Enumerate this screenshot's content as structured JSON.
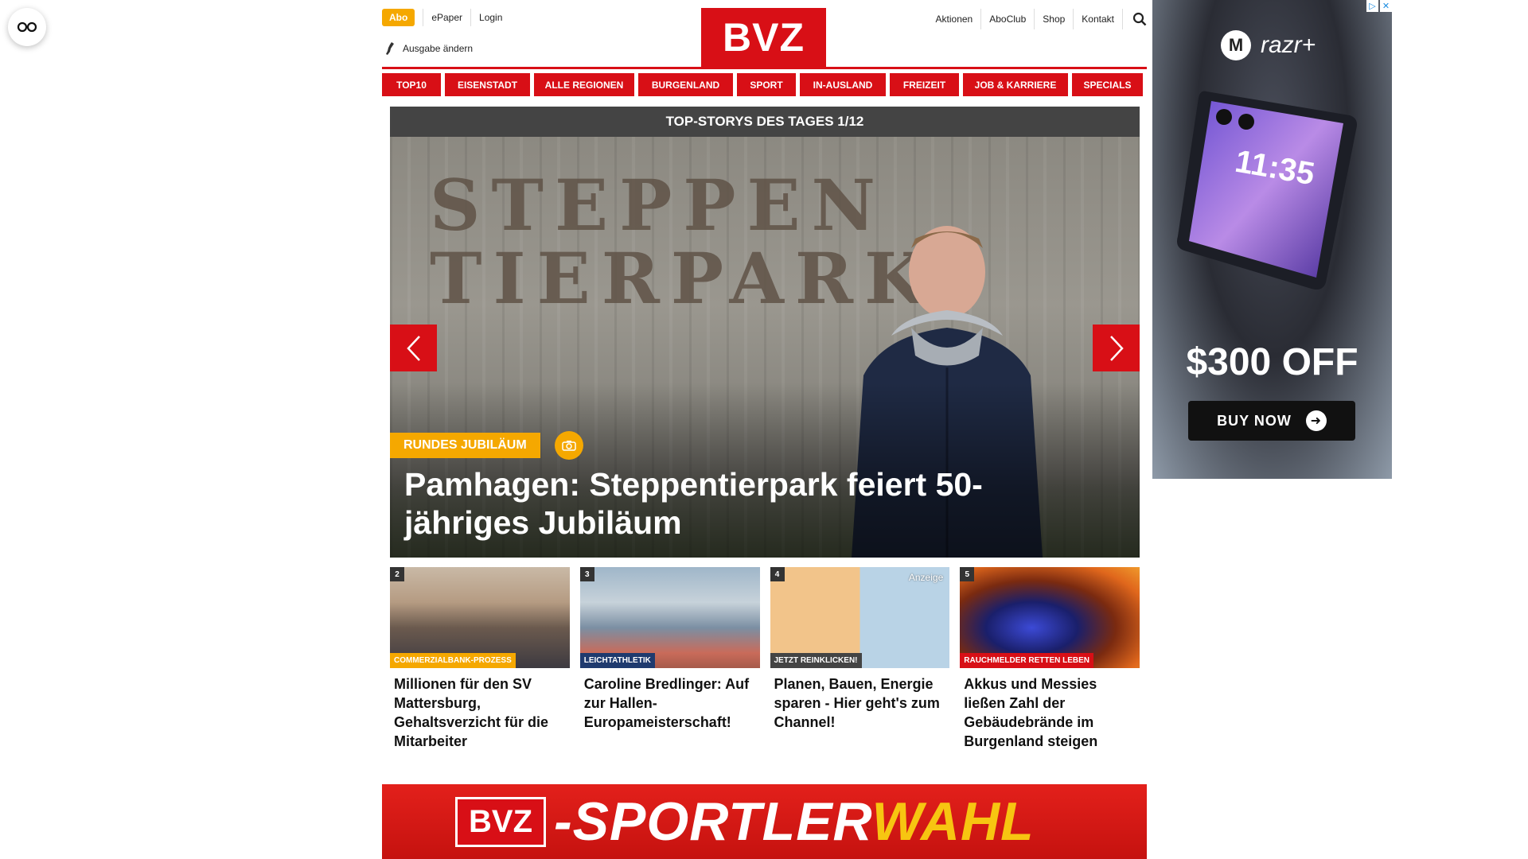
{
  "header": {
    "abo": "Abo",
    "epaper": "ePaper",
    "login": "Login",
    "edition": "Ausgabe ändern",
    "logo": "BVZ",
    "links": [
      "Aktionen",
      "AboClub",
      "Shop",
      "Kontakt"
    ]
  },
  "nav": [
    "TOP10",
    "EISENSTADT",
    "ALLE REGIONEN",
    "BURGENLAND",
    "SPORT",
    "IN-AUSLAND",
    "FREIZEIT",
    "JOB & KARRIERE",
    "SPECIALS"
  ],
  "hero": {
    "bar": "TOP-STORYS DES TAGES 1/12",
    "fence_text": "STEPPEN TIERPARK",
    "kicker": "RUNDES JUBILÄUM",
    "title": "Pamhagen: Steppentierpark feiert 50-jähriges Jubiläum"
  },
  "teasers": [
    {
      "num": "2",
      "kicker": "COMMERZIALBANK-PROZESS",
      "kicker_color": "#f5a800",
      "title": "Millionen für den SV Mattersburg, Gehaltsverzicht für die Mitarbeiter"
    },
    {
      "num": "3",
      "kicker": "LEICHTATHLETIK",
      "kicker_color": "#1f3a6e",
      "title": "Caroline Bredlinger: Auf zur Hallen-Europameisterschaft!"
    },
    {
      "num": "4",
      "kicker": "JETZT REINKLICKEN!",
      "kicker_color": "#444444",
      "anzeige": "Anzeige",
      "title": "Planen, Bauen, Energie sparen - Hier geht's zum Channel!"
    },
    {
      "num": "5",
      "kicker": "RAUCHMELDER RETTEN LEBEN",
      "kicker_color": "#d80f16",
      "title": "Akkus und Messies ließen Zahl der Gebäudebrände im Burgenland steigen"
    }
  ],
  "banner": {
    "logo": "BVZ",
    "text_white": "-SPORTLER",
    "text_yellow": "WAHL"
  },
  "ad": {
    "brand": "razr+",
    "phone_time": "11:35",
    "offer": "$300 OFF",
    "cta": "BUY NOW"
  },
  "colors": {
    "brand_red": "#d80f16",
    "accent_yellow": "#f5a800",
    "hero_bar": "#444444"
  }
}
